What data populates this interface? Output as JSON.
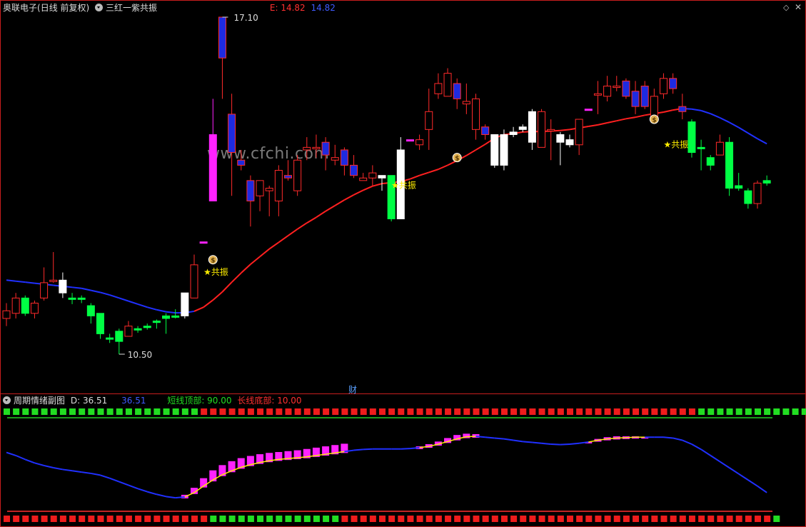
{
  "main_header": {
    "stock_name": "奥联电子",
    "period_mode": "(日线 前复权)",
    "indicator_name": "三红一紫共振",
    "e_label": "E: 14.82",
    "e_value2": "14.82"
  },
  "sub_header": {
    "indicator_name": "周期情绪副图",
    "d_label": "D: 36.51",
    "d_value2": "36.51",
    "short_top_label": "短线顶部: 90.00",
    "long_bottom_label": "长线底部: 10.00"
  },
  "watermark": "www.cfchi.com",
  "finance_marker": "财",
  "annotations": {
    "high_price": "17.10",
    "low_price": "10.50",
    "resonance_label": "★共振"
  },
  "colors": {
    "up": "#ff2a2a",
    "down": "#00ff44",
    "blue_body": "#1e2be0",
    "magenta": "#ff22ff",
    "white": "#ffffff",
    "ma_red": "#ff2020",
    "ma_blue": "#2030ff",
    "star": "#ffee00"
  },
  "price_scale": {
    "max": 17.1,
    "min": 10.5
  },
  "candles": [
    [
      11.2,
      11.5,
      11.05,
      11.35,
      "up"
    ],
    [
      11.3,
      11.7,
      11.2,
      11.6,
      "up"
    ],
    [
      11.6,
      11.65,
      11.25,
      11.3,
      "down"
    ],
    [
      11.3,
      11.55,
      11.2,
      11.5,
      "up"
    ],
    [
      11.6,
      12.2,
      11.55,
      11.9,
      "up"
    ],
    [
      11.95,
      12.5,
      11.9,
      11.95,
      "up"
    ],
    [
      11.95,
      12.1,
      11.6,
      11.7,
      "white"
    ],
    [
      11.58,
      11.7,
      11.48,
      11.6,
      "down"
    ],
    [
      11.6,
      11.65,
      11.5,
      11.58,
      "down"
    ],
    [
      11.45,
      11.5,
      11.1,
      11.25,
      "down"
    ],
    [
      11.3,
      11.3,
      10.8,
      10.9,
      "down"
    ],
    [
      10.82,
      10.9,
      10.72,
      10.82,
      "down"
    ],
    [
      10.95,
      11.0,
      10.5,
      10.75,
      "down"
    ],
    [
      10.85,
      11.15,
      10.85,
      11.05,
      "up"
    ],
    [
      11.0,
      11.05,
      10.92,
      11.0,
      "down"
    ],
    [
      11.02,
      11.1,
      10.98,
      11.05,
      "down"
    ],
    [
      11.12,
      11.18,
      11.0,
      11.15,
      "down"
    ],
    [
      11.2,
      11.3,
      10.9,
      11.25,
      "down"
    ],
    [
      11.25,
      11.38,
      11.2,
      11.25,
      "down"
    ],
    [
      11.25,
      11.7,
      11.2,
      11.7,
      "white"
    ],
    [
      11.6,
      12.45,
      11.6,
      12.25,
      "up"
    ],
    [
      12.7,
      12.7,
      12.7,
      12.7,
      "magenta"
    ],
    [
      13.5,
      15.5,
      13.5,
      14.8,
      "magenta"
    ],
    [
      17.1,
      17.1,
      15.5,
      16.3,
      "blue"
    ],
    [
      15.2,
      15.6,
      13.6,
      14.45,
      "blue"
    ],
    [
      14.3,
      14.5,
      14.1,
      14.2,
      "blue"
    ],
    [
      13.9,
      14.0,
      13.0,
      13.5,
      "blue"
    ],
    [
      13.6,
      13.9,
      13.3,
      13.9,
      "up"
    ],
    [
      13.7,
      13.8,
      13.2,
      13.75,
      "up"
    ],
    [
      13.5,
      14.2,
      13.2,
      14.1,
      "up"
    ],
    [
      13.95,
      14.3,
      13.9,
      14.0,
      "blue"
    ],
    [
      13.7,
      14.4,
      13.6,
      14.3,
      "up"
    ],
    [
      14.5,
      14.75,
      14.3,
      14.55,
      "up"
    ],
    [
      14.55,
      14.8,
      14.35,
      14.55,
      "up"
    ],
    [
      14.65,
      14.75,
      14.1,
      14.4,
      "blue"
    ],
    [
      14.3,
      14.6,
      14.2,
      14.35,
      "up"
    ],
    [
      14.5,
      14.55,
      14.0,
      14.2,
      "blue"
    ],
    [
      14.2,
      14.4,
      13.95,
      14.0,
      "blue"
    ],
    [
      13.9,
      14.05,
      13.9,
      13.95,
      "up"
    ],
    [
      14.05,
      14.2,
      13.8,
      13.95,
      "up"
    ],
    [
      13.95,
      14.0,
      13.7,
      14.0,
      "white"
    ],
    [
      14.0,
      14.0,
      13.1,
      13.15,
      "down"
    ],
    [
      13.15,
      14.75,
      13.15,
      14.5,
      "white"
    ],
    [
      14.7,
      14.7,
      14.7,
      14.7,
      "magenta"
    ],
    [
      14.6,
      14.8,
      14.5,
      14.7,
      "up"
    ],
    [
      14.9,
      15.7,
      14.5,
      15.25,
      "up"
    ],
    [
      15.8,
      16.0,
      15.5,
      15.6,
      "up"
    ],
    [
      15.55,
      16.1,
      15.55,
      16.0,
      "up"
    ],
    [
      15.8,
      15.9,
      15.3,
      15.5,
      "blue"
    ],
    [
      15.4,
      15.8,
      15.2,
      15.45,
      "up"
    ],
    [
      15.5,
      15.6,
      14.7,
      14.9,
      "up"
    ],
    [
      14.95,
      15.0,
      14.7,
      14.8,
      "blue"
    ],
    [
      14.8,
      14.8,
      14.15,
      14.2,
      "white"
    ],
    [
      14.8,
      14.9,
      14.1,
      14.2,
      "white"
    ],
    [
      14.8,
      14.95,
      14.75,
      14.85,
      "white"
    ],
    [
      14.95,
      15.0,
      14.85,
      14.9,
      "white"
    ],
    [
      15.25,
      15.3,
      14.5,
      14.65,
      "white"
    ],
    [
      14.55,
      15.3,
      14.55,
      15.25,
      "up"
    ],
    [
      14.9,
      15.1,
      14.3,
      14.9,
      "up"
    ],
    [
      14.8,
      14.85,
      14.2,
      14.65,
      "white"
    ],
    [
      14.6,
      14.8,
      14.55,
      14.7,
      "white"
    ],
    [
      14.6,
      15.1,
      14.4,
      15.1,
      "up"
    ],
    [
      15.3,
      15.3,
      15.3,
      15.3,
      "magenta"
    ],
    [
      15.6,
      15.85,
      15.2,
      15.6,
      "up"
    ],
    [
      15.55,
      15.95,
      15.45,
      15.75,
      "up"
    ],
    [
      15.75,
      15.95,
      15.65,
      15.75,
      "up"
    ],
    [
      15.85,
      15.9,
      15.5,
      15.55,
      "blue"
    ],
    [
      15.65,
      15.85,
      15.2,
      15.35,
      "blue"
    ],
    [
      15.75,
      15.85,
      15.3,
      15.35,
      "blue"
    ],
    [
      15.15,
      15.7,
      15.1,
      15.55,
      "up"
    ],
    [
      15.6,
      16.0,
      15.5,
      15.9,
      "up"
    ],
    [
      15.9,
      16.0,
      15.6,
      15.7,
      "blue"
    ],
    [
      15.35,
      15.6,
      15.1,
      15.25,
      "blue"
    ],
    [
      15.05,
      15.1,
      14.35,
      14.45,
      "down"
    ],
    [
      14.55,
      14.7,
      14.1,
      14.55,
      "down"
    ],
    [
      14.2,
      14.4,
      14.1,
      14.35,
      "down"
    ],
    [
      14.4,
      14.8,
      14.4,
      14.65,
      "up"
    ],
    [
      14.65,
      14.75,
      13.6,
      13.75,
      "down"
    ],
    [
      13.8,
      14.05,
      13.7,
      13.75,
      "down"
    ],
    [
      13.7,
      13.75,
      13.35,
      13.45,
      "down"
    ],
    [
      13.45,
      13.9,
      13.35,
      13.85,
      "up"
    ],
    [
      13.85,
      14.0,
      13.8,
      13.9,
      "down"
    ]
  ],
  "long_ma": [
    11.95,
    11.93,
    11.91,
    11.89,
    11.87,
    11.85,
    11.83,
    11.81,
    11.79,
    11.75,
    11.71,
    11.66,
    11.6,
    11.54,
    11.48,
    11.42,
    11.37,
    11.33,
    11.31,
    11.31,
    11.34,
    11.42,
    11.56,
    11.72,
    11.91,
    12.09,
    12.26,
    12.41,
    12.56,
    12.69,
    12.82,
    12.95,
    13.07,
    13.18,
    13.3,
    13.41,
    13.52,
    13.62,
    13.71,
    13.79,
    13.84,
    13.86,
    13.88,
    13.93,
    14.0,
    14.06,
    14.12,
    14.2,
    14.29,
    14.39,
    14.5,
    14.61,
    14.73,
    14.8,
    14.82,
    14.85,
    14.86,
    14.86,
    14.87,
    14.88,
    14.9,
    14.93,
    14.96,
    14.99,
    15.03,
    15.07,
    15.11,
    15.14,
    15.18,
    15.21,
    15.24,
    15.28,
    15.31,
    15.3,
    15.27,
    15.21,
    15.13,
    15.04,
    14.94,
    14.83,
    14.72,
    14.62
  ],
  "long_ma_red": [
    0,
    0,
    0,
    0,
    0,
    0,
    0,
    0,
    0,
    0,
    0,
    0,
    0,
    0,
    0,
    0,
    0,
    0,
    0,
    0,
    1,
    1,
    1,
    1,
    1,
    1,
    1,
    1,
    1,
    1,
    1,
    1,
    1,
    1,
    1,
    1,
    1,
    1,
    1,
    1,
    1,
    1,
    1,
    1,
    1,
    1,
    1,
    1,
    1,
    1,
    1,
    1,
    1,
    1,
    1,
    1,
    1,
    1,
    1,
    1,
    1,
    1,
    1,
    1,
    1,
    1,
    1,
    1,
    1,
    1,
    1,
    1,
    1,
    0,
    0,
    0,
    0,
    0,
    0,
    0,
    0,
    0
  ],
  "stars": [
    {
      "i": 21,
      "price": 12.05,
      "type": "resonance"
    },
    {
      "i": 41,
      "price": 13.75,
      "type": "resonance"
    },
    {
      "i": 70,
      "price": 14.55,
      "type": "resonance"
    },
    {
      "i": 22,
      "price": 12.35,
      "type": "moneybag"
    },
    {
      "i": 48,
      "price": 14.35,
      "type": "moneybag"
    },
    {
      "i": 69,
      "price": 15.1,
      "type": "moneybag"
    }
  ],
  "osc_line": [
    30.5,
    29.8,
    28.9,
    28.1,
    27.5,
    27.0,
    26.6,
    26.3,
    26.0,
    25.7,
    25.3,
    24.6,
    23.8,
    23.0,
    22.2,
    21.5,
    20.9,
    20.4,
    20.1,
    20.3,
    21.3,
    22.8,
    24.2,
    25.4,
    26.3,
    27.1,
    27.7,
    28.2,
    28.6,
    28.9,
    29.1,
    29.3,
    29.5,
    29.8,
    30.1,
    30.4,
    30.7,
    31.0,
    31.2,
    31.3,
    31.3,
    31.3,
    31.3,
    31.4,
    31.6,
    31.9,
    32.4,
    33.0,
    33.6,
    34.1,
    34.2,
    34.0,
    33.8,
    33.6,
    33.3,
    33.0,
    32.8,
    32.6,
    32.4,
    32.3,
    32.4,
    32.6,
    32.9,
    33.3,
    33.6,
    33.8,
    33.9,
    34.0,
    34.0,
    34.0,
    34.0,
    33.8,
    33.3,
    32.4,
    31.2,
    29.8,
    28.4,
    27.0,
    25.6,
    24.2,
    22.8,
    21.3
  ],
  "osc_bars": [
    0,
    0,
    0,
    0,
    0,
    0,
    0,
    0,
    0,
    0,
    0,
    0,
    0,
    0,
    0,
    0,
    0,
    0,
    0,
    20.8,
    22.4,
    24.6,
    26.4,
    27.6,
    28.5,
    29.2,
    29.7,
    30.1,
    30.4,
    30.6,
    30.8,
    31.0,
    31.3,
    31.6,
    31.9,
    32.2,
    32.5,
    0,
    0,
    0,
    0,
    0,
    0,
    0,
    31.9,
    32.4,
    33.0,
    33.8,
    34.5,
    34.8,
    34.7,
    0,
    0,
    0,
    0,
    0,
    0,
    0,
    0,
    0,
    0,
    0,
    32.9,
    33.6,
    34.0,
    34.2,
    34.2,
    34.2,
    34.1,
    0,
    0,
    0,
    0,
    0,
    0,
    0,
    0,
    0,
    0,
    0,
    0,
    0
  ],
  "top_squares": [
    "g",
    "g",
    "g",
    "g",
    "g",
    "g",
    "g",
    "g",
    "g",
    "g",
    "g",
    "g",
    "g",
    "g",
    "g",
    "g",
    "g",
    "g",
    "g",
    "g",
    "g",
    "r",
    "r",
    "r",
    "r",
    "r",
    "r",
    "r",
    "r",
    "r",
    "r",
    "r",
    "r",
    "r",
    "r",
    "r",
    "r",
    "r",
    "r",
    "r",
    "r",
    "r",
    "r",
    "r",
    "r",
    "r",
    "r",
    "r",
    "r",
    "r",
    "r",
    "r",
    "r",
    "r",
    "r",
    "r",
    "r",
    "r",
    "r",
    "r",
    "r",
    "r",
    "r",
    "r",
    "r",
    "r",
    "r",
    "r",
    "r",
    "r",
    "r",
    "r",
    "r",
    "r",
    "g",
    "g",
    "g",
    "g",
    "g",
    "g",
    "g",
    "g",
    "g",
    "g",
    "g",
    "g",
    "g"
  ],
  "bottom_squares": [
    "r",
    "r",
    "r",
    "r",
    "r",
    "r",
    "r",
    "r",
    "r",
    "r",
    "r",
    "r",
    "r",
    "r",
    "r",
    "r",
    "r",
    "r",
    "r",
    "r",
    "r",
    "r",
    "g",
    "g",
    "g",
    "g",
    "g",
    "g",
    "g",
    "g",
    "g",
    "g",
    "g",
    "g",
    "g",
    "g",
    "r",
    "r",
    "r",
    "r",
    "r",
    "r",
    "r",
    "r",
    "r",
    "r",
    "r",
    "r",
    "r",
    "r",
    "r",
    "r",
    "r",
    "r",
    "r",
    "r",
    "r",
    "r",
    "r",
    "r",
    "r",
    "r",
    "r",
    "r",
    "r",
    "r",
    "r",
    "r",
    "r",
    "r",
    "r",
    "r",
    "r",
    "r",
    "r",
    "r",
    "r",
    "r",
    "r",
    "r",
    "r",
    "r",
    "g"
  ]
}
